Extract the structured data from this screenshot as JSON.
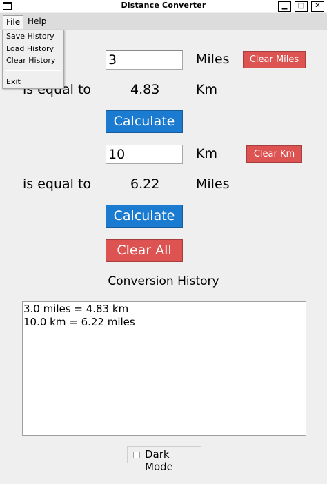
{
  "window": {
    "title": "Distance Converter",
    "minimize_glyph": "▁",
    "maximize_glyph": "□",
    "close_glyph": "✕"
  },
  "menubar": {
    "file": "File",
    "help": "Help"
  },
  "file_menu": {
    "items": [
      "Save History",
      "Load History",
      "Clear History",
      "Exit"
    ]
  },
  "miles_section": {
    "input_value": "3",
    "unit_label": "Miles",
    "clear_label": "Clear Miles",
    "equal_label": "is equal to",
    "result": "4.83",
    "result_unit": "Km",
    "calculate_label": "Calculate"
  },
  "km_section": {
    "input_value": "10",
    "unit_label": "Km",
    "clear_label": "Clear Km",
    "equal_label": "is equal to",
    "result": "6.22",
    "result_unit": "Miles",
    "calculate_label": "Calculate"
  },
  "clear_all_label": "Clear All",
  "history": {
    "heading": "Conversion History",
    "lines": [
      "3.0 miles = 4.83 km",
      "10.0 km = 6.22 miles"
    ]
  },
  "dark_mode": {
    "label": "Dark Mode",
    "checked": false
  },
  "colors": {
    "primary_button": "#1b7bd0",
    "danger_button": "#dc5352",
    "background": "#efefef"
  }
}
